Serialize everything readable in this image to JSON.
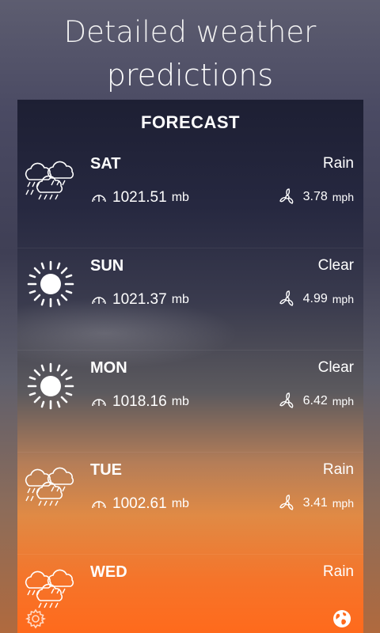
{
  "promo": {
    "line1": "Detailed weather",
    "line2": "predictions"
  },
  "forecast": {
    "title": "FORECAST",
    "rows": [
      {
        "day": "SAT",
        "condition": "Rain",
        "icon": "rain-cloud-icon",
        "pressure": "1021.51",
        "pressure_unit": "mb",
        "wind": "3.78",
        "wind_unit": "mph"
      },
      {
        "day": "SUN",
        "condition": "Clear",
        "icon": "sun-icon",
        "pressure": "1021.37",
        "pressure_unit": "mb",
        "wind": "4.99",
        "wind_unit": "mph"
      },
      {
        "day": "MON",
        "condition": "Clear",
        "icon": "sun-icon",
        "pressure": "1018.16",
        "pressure_unit": "mb",
        "wind": "6.42",
        "wind_unit": "mph"
      },
      {
        "day": "TUE",
        "condition": "Rain",
        "icon": "rain-cloud-icon",
        "pressure": "1002.61",
        "pressure_unit": "mb",
        "wind": "3.41",
        "wind_unit": "mph"
      },
      {
        "day": "WED",
        "condition": "Rain",
        "icon": "rain-cloud-icon"
      }
    ]
  },
  "bottom_bar": {
    "left_icon": "gear-icon",
    "right_icon": "globe-icon"
  },
  "colors": {
    "text": "#ffffff",
    "panel_top": "#1d1f33",
    "panel_bottom": "#ff6a1c"
  }
}
